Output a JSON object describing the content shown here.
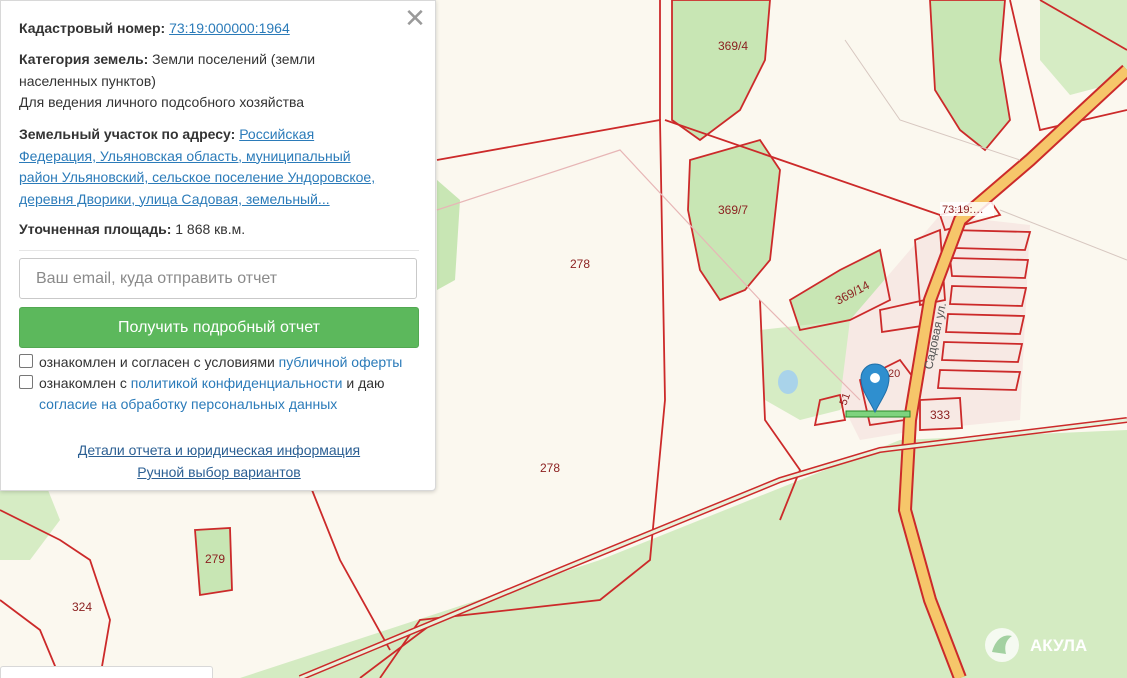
{
  "panel": {
    "cadastral_label": "Кадастровый номер:",
    "cadastral_number": "73:19:000000:1964",
    "category_label": "Категория земель:",
    "category_value_1": "Земли поселений (земли",
    "category_value_2": "населенных пунктов)",
    "category_value_3": "Для ведения личного подсобного хозяйства",
    "address_label": "Земельный участок по адресу:",
    "address_1": "Российская",
    "address_2": "Федерация, Ульяновская область, муниципальный",
    "address_3": "район Ульяновский, сельское поселение Ундоровское,",
    "address_4": "деревня Дворики, улица Садовая, земельный...",
    "area_label": "Уточненная площадь:",
    "area_value": "1 868 кв.м.",
    "email_placeholder": "Ваш email, куда отправить отчет",
    "get_report_label": "Получить подробный отчет",
    "checkbox1_text": "ознакомлен и согласен с условиями",
    "checkbox1_link": "публичной оферты",
    "checkbox2_text_a": "ознакомлен с",
    "checkbox2_link_a": "политикой конфиденциальности",
    "checkbox2_text_b": "и даю",
    "checkbox2_link_b": "согласие на обработку персональных данных",
    "details_link": "Детали отчета и юридическая информация",
    "manual_link": "Ручной выбор вариантов",
    "close_glyph": "✕"
  },
  "map": {
    "labels": {
      "l369_4": "369/4",
      "l369_7": "369/7",
      "l369_14": "369/14",
      "l278_top": "278",
      "l278_bottom": "278",
      "l279": "279",
      "l324": "324",
      "l333": "333",
      "l51": "51",
      "l20": "20",
      "street": "Садовая ул.",
      "road_code": "73:19:…"
    },
    "watermark": "АКУЛА",
    "colors": {
      "background": "#fbf8ef",
      "forest": "#c8e6b4",
      "boundary": "#cc2a2a",
      "road": "#f6c66a",
      "marker": "#2f8fcf",
      "button": "#5cb85c"
    }
  }
}
